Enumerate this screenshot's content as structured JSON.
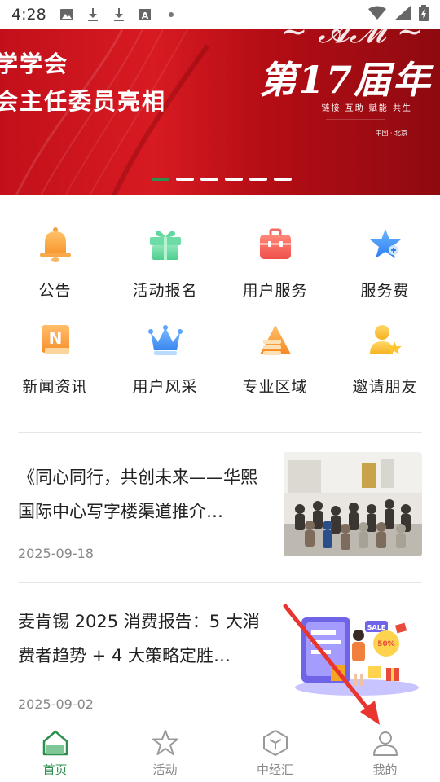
{
  "status_bar": {
    "time": "4:28",
    "icons_left": [
      "image-icon",
      "download-icon",
      "download-icon",
      "font-icon",
      "dot-icon"
    ],
    "icons_right": [
      "wifi-icon",
      "signal-icon",
      "battery-icon"
    ]
  },
  "banner": {
    "left_line1": "学学会",
    "left_line2": "会主任委员亮相",
    "right_title": "第17届年",
    "slogan": "链接 互助 赋能 共生",
    "location": "中国 · 北京",
    "slide_count": 6,
    "active_slide": 0,
    "colors": {
      "red": "#c2101a",
      "dark_red": "#8e0a10",
      "dot_active": "#2f8f4f"
    }
  },
  "grid": {
    "items": [
      {
        "label": "公告",
        "icon": "bell-icon"
      },
      {
        "label": "活动报名",
        "icon": "gift-icon"
      },
      {
        "label": "用户服务",
        "icon": "briefcase-icon"
      },
      {
        "label": "服务费",
        "icon": "star-icon"
      },
      {
        "label": "新闻资讯",
        "icon": "news-icon"
      },
      {
        "label": "用户风采",
        "icon": "crown-icon"
      },
      {
        "label": "专业区域",
        "icon": "layers-icon"
      },
      {
        "label": "邀请朋友",
        "icon": "invite-user-icon"
      }
    ]
  },
  "news": [
    {
      "title": "《同心同行，共创未来——华熙国际中心写字楼渠道推介…",
      "date": "2025-09-18",
      "thumb": "event-photo"
    },
    {
      "title": "麦肯锡 2025 消费报告：5 大消费者趋势 + 4 大策略定胜…",
      "date": "2025-09-02",
      "thumb": "shopping-illustration"
    }
  ],
  "bottom_nav": {
    "items": [
      {
        "label": "首页",
        "icon": "home-icon",
        "active": true
      },
      {
        "label": "活动",
        "icon": "star-outline-icon",
        "active": false
      },
      {
        "label": "中经汇",
        "icon": "cube-icon",
        "active": false
      },
      {
        "label": "我的",
        "icon": "user-icon",
        "active": false
      }
    ],
    "accent": "#2f8f4f"
  }
}
